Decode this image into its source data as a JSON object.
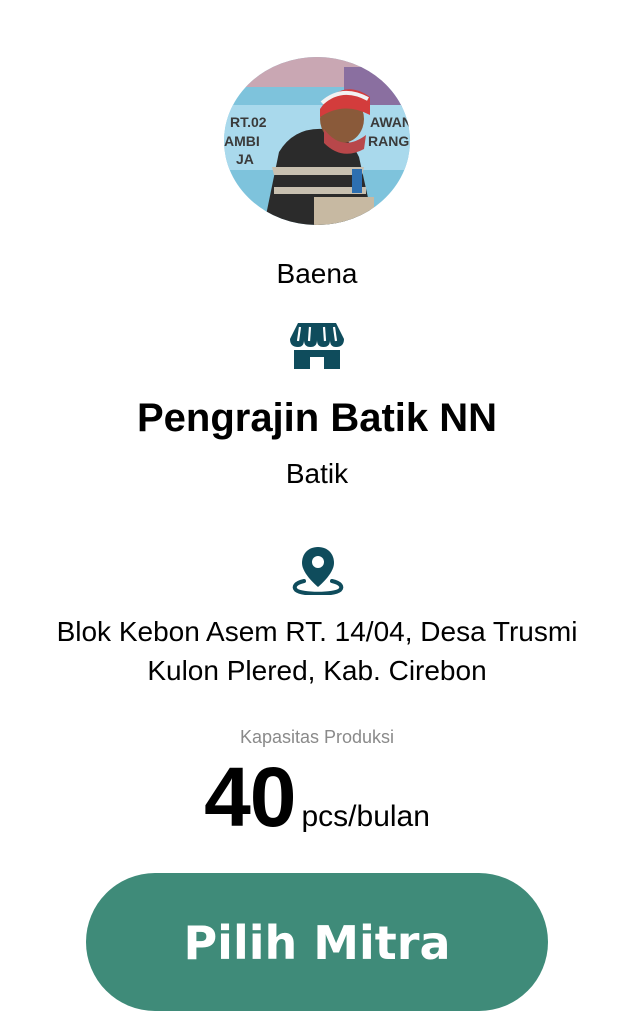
{
  "profile": {
    "avatar_alt": "Foto pengrajin",
    "avatar_sign_text": [
      "RT.02",
      "AWAN",
      "AMBI",
      "RANG",
      "JA"
    ],
    "person_name": "Baena",
    "business_icon": "storefront-icon",
    "business_name": "Pengrajin Batik NN",
    "category": "Batik",
    "location_icon": "map-pin-icon",
    "address": "Blok Kebon Asem RT. 14/04, Desa Trusmi Kulon Plered, Kab. Cirebon"
  },
  "capacity": {
    "label": "Kapasitas Produksi",
    "value": "40",
    "unit": "pcs/bulan"
  },
  "action": {
    "select_label": "Pilih Mitra"
  },
  "colors": {
    "accent": "#3f8b79",
    "icon": "#0f4c5c",
    "muted_text": "#8a8a8a"
  }
}
